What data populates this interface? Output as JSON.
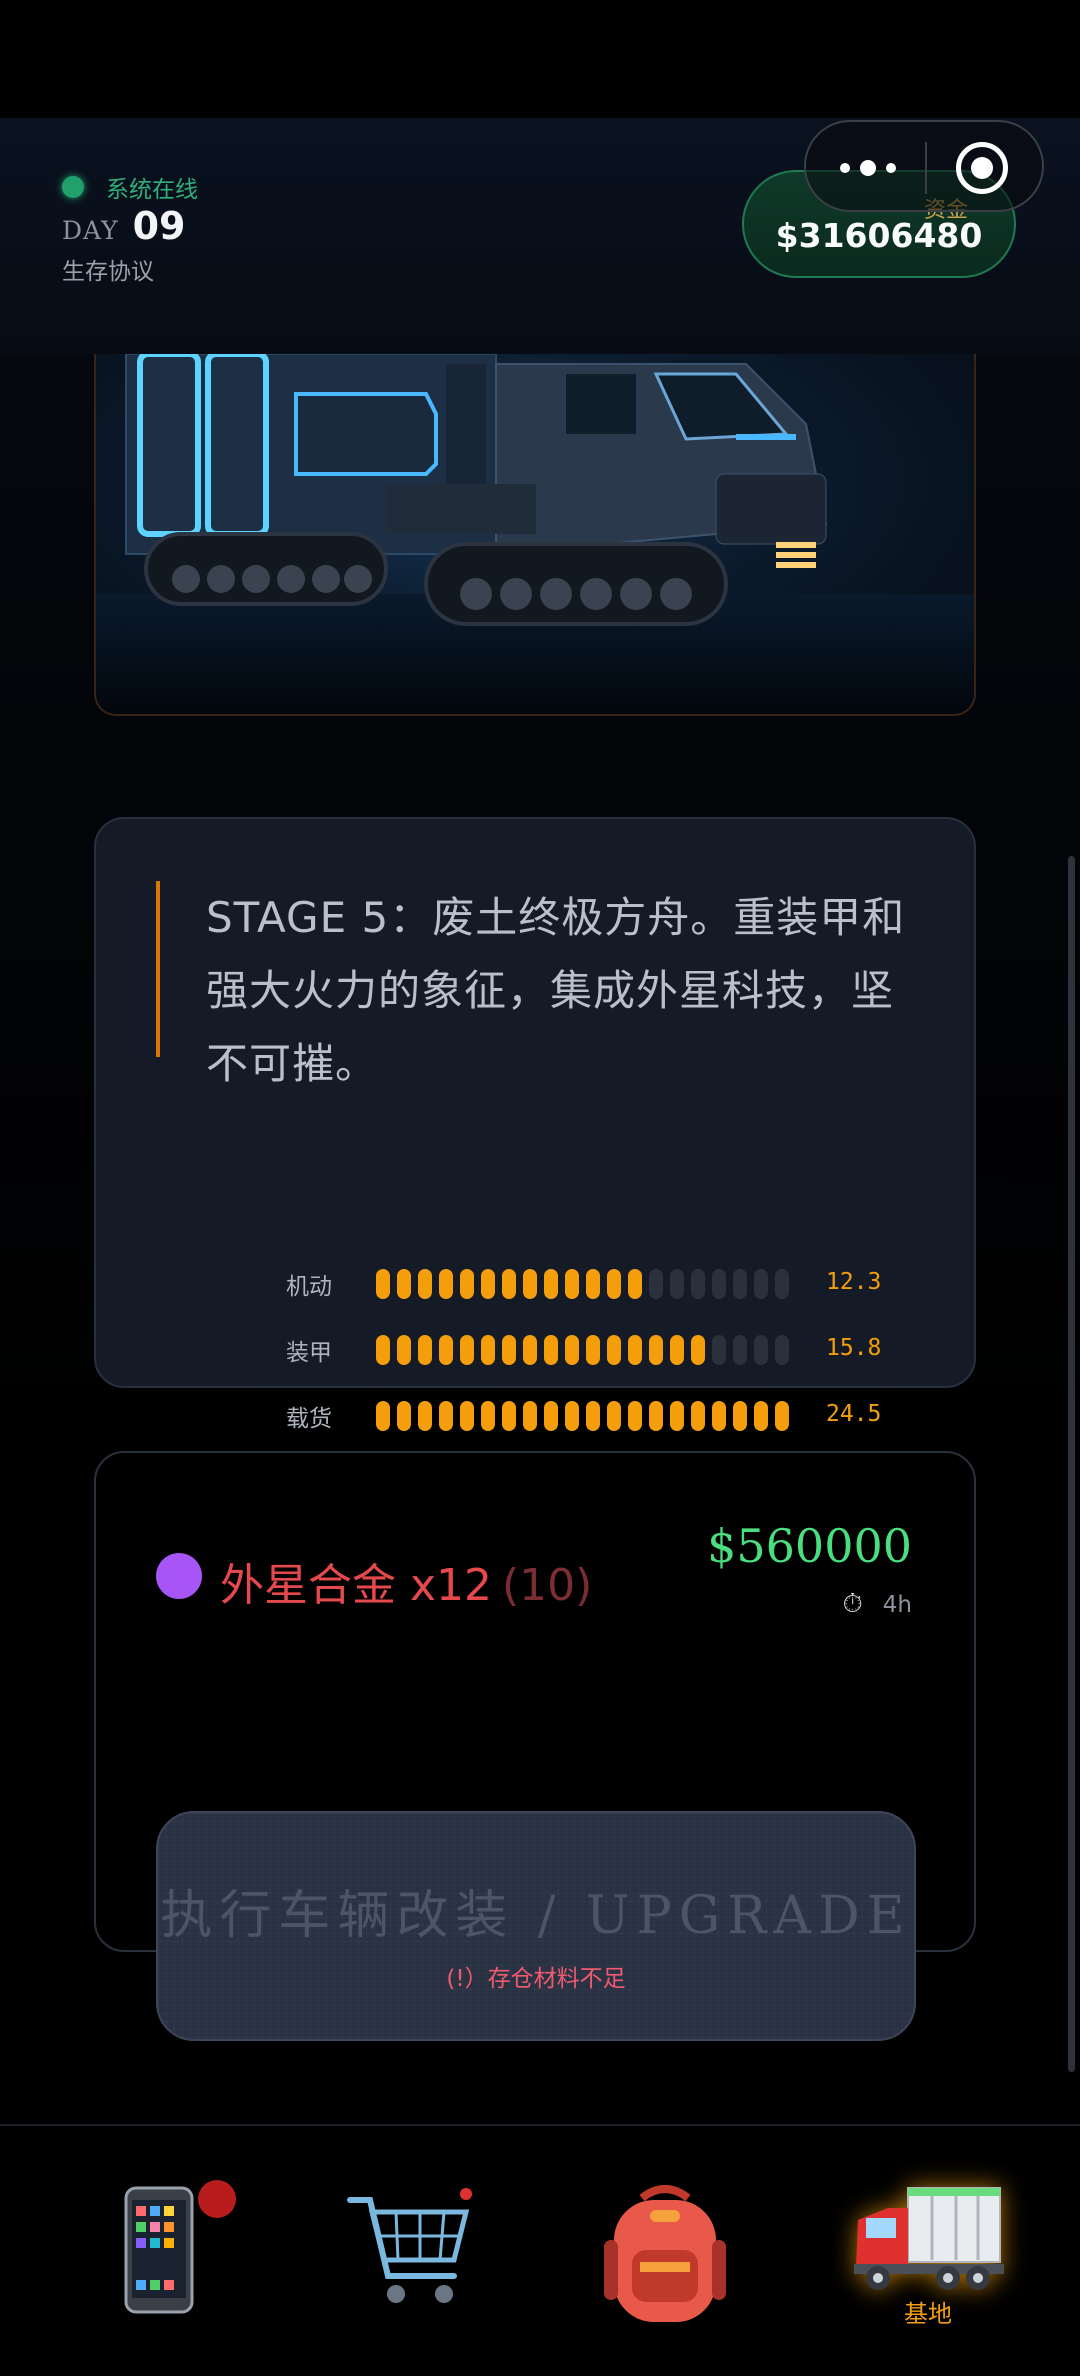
{
  "header": {
    "status_text": "系统在线",
    "day_label": "DAY",
    "day_number": "09",
    "protocol": "生存协议",
    "funds_label": "资金",
    "funds_value": "$31606480"
  },
  "stage": {
    "description": "STAGE 5：废土终极方舟。重装甲和强大火力的象征，集成外星科技，坚不可摧。",
    "stats": [
      {
        "label": "机动",
        "value": "12.3",
        "fraction": 0.65
      },
      {
        "label": "装甲",
        "value": "15.8",
        "fraction": 0.8
      },
      {
        "label": "载货",
        "value": "24.5",
        "fraction": 1.0
      }
    ]
  },
  "material": {
    "name": "外星合金 x12",
    "required": "(10)",
    "price": "$560000",
    "time_icon": "stopwatch-icon",
    "time": "4h"
  },
  "upgrade": {
    "label": "执行车辆改装 / UPGRADE",
    "warning": "(!）存仓材料不足"
  },
  "nav": {
    "items": [
      {
        "icon": "phone-icon",
        "label": "",
        "badge": true
      },
      {
        "icon": "shopping-cart-icon",
        "label": ""
      },
      {
        "icon": "backpack-icon",
        "label": ""
      },
      {
        "icon": "truck-icon",
        "label": "基地",
        "active": true
      }
    ]
  },
  "colors": {
    "accent": "#f59e0b",
    "online": "#22a06b",
    "price": "#4ade80",
    "material": "#e5484d",
    "warning": "#f05a70"
  }
}
